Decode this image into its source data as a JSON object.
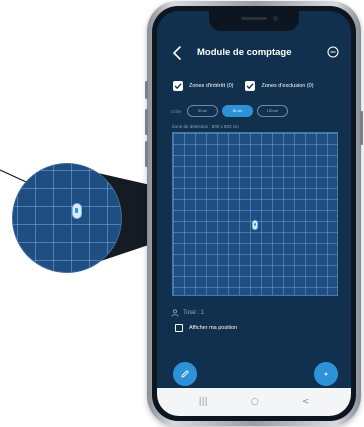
{
  "header": {
    "title": "Module de comptage",
    "back_icon": "chevron-left-icon",
    "menu_icon": "minus-circle-icon"
  },
  "filters": {
    "interest_label": "Zones d'intérêt (0)",
    "interest_checked": true,
    "exclusion_label": "Zones d'exclusion (0)",
    "exclusion_checked": true
  },
  "grid": {
    "label": "Grille",
    "options": [
      "30 cm",
      "60 cm",
      "100 cm"
    ],
    "selected": "60 cm"
  },
  "zone": {
    "label": "Zone de détection : 800 x 803 cm"
  },
  "total": {
    "icon": "person-icon",
    "text": "Total : 1"
  },
  "position": {
    "label": "Afficher ma position",
    "checked": false
  },
  "fab": {
    "left_icon": "pencil-icon",
    "right_icon": "plus-icon"
  },
  "navbar": {
    "recent": "|||",
    "home": "○",
    "back": "<"
  },
  "colors": {
    "background": "#11304d",
    "accent": "#2d93d6",
    "grid": "#1e4e82"
  }
}
